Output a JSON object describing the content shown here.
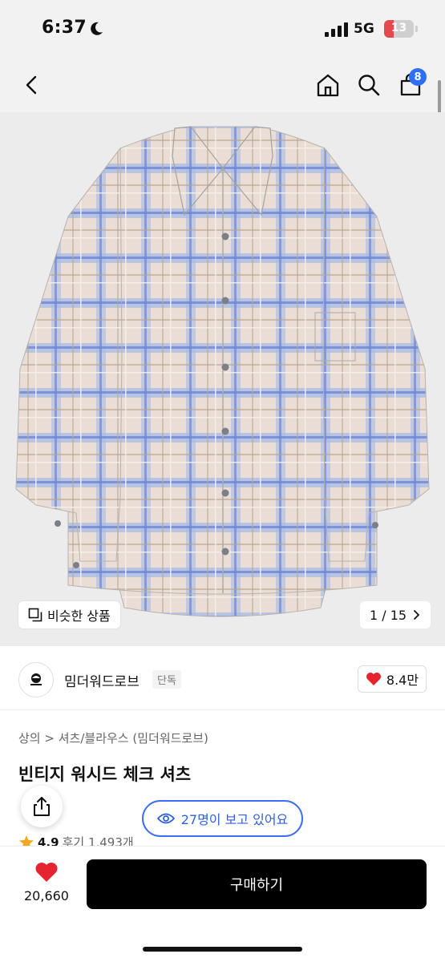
{
  "status": {
    "time": "6:37",
    "network": "5G",
    "battery": "13"
  },
  "nav": {
    "cart_count": "8"
  },
  "gallery": {
    "similar_label": "비슷한 상품",
    "page_indicator": "1 / 15"
  },
  "brand": {
    "name": "밈더워드로브",
    "tag": "단독",
    "likes": "8.4만"
  },
  "breadcrumb": {
    "category": "상의",
    "separator": ">",
    "subcategory": "셔츠/블라우스 (밈더워드로브)"
  },
  "product": {
    "title": "빈티지 워시드 체크 셔츠",
    "rating": "4.9",
    "reviews": "후기 1,493개"
  },
  "viewers": {
    "text": "27명이 보고 있어요"
  },
  "bottom": {
    "like_count": "20,660",
    "buy_label": "구매하기"
  },
  "colors": {
    "accent_blue": "#3b6ef6",
    "heart_red": "#e5242f",
    "buy_black": "#000000"
  }
}
